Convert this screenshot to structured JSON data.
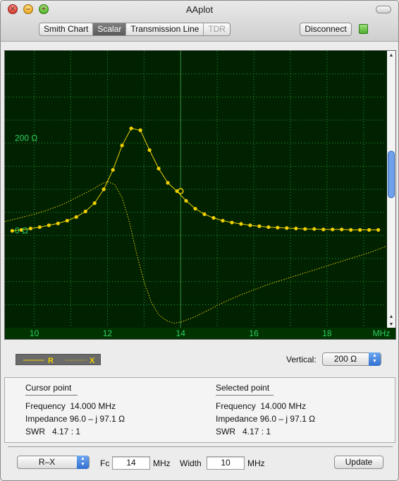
{
  "window": {
    "title": "AAplot"
  },
  "tabs": [
    {
      "label": "Smith Chart",
      "state": "normal"
    },
    {
      "label": "Scalar",
      "state": "active"
    },
    {
      "label": "Transmission Line",
      "state": "normal"
    },
    {
      "label": "TDR",
      "state": "disabled"
    }
  ],
  "toolbar": {
    "disconnect_label": "Disconnect",
    "status_led": "connected-green-led"
  },
  "chart_data": {
    "type": "line",
    "title": "",
    "xlabel": "MHz",
    "ylabel": "",
    "xlim": [
      9.2,
      19.6
    ],
    "ylim": [
      -200,
      400
    ],
    "x_ticks": [
      10,
      12,
      14,
      16,
      18
    ],
    "y_labels": [
      {
        "value": 200,
        "text": "200 Ω"
      },
      {
        "value": 0,
        "text": "0 Ω"
      }
    ],
    "cursor_x": 14,
    "selected_point": {
      "x": 14,
      "y": 96.0
    },
    "series": [
      {
        "name": "R",
        "style": "solid-with-markers",
        "x": [
          9.4,
          9.65,
          9.9,
          10.15,
          10.4,
          10.65,
          10.9,
          11.15,
          11.4,
          11.65,
          11.9,
          12.15,
          12.4,
          12.65,
          12.9,
          13.15,
          13.4,
          13.65,
          13.9,
          14.15,
          14.4,
          14.65,
          14.9,
          15.15,
          15.4,
          15.65,
          15.9,
          16.15,
          16.4,
          16.65,
          16.9,
          17.15,
          17.4,
          17.65,
          17.9,
          18.15,
          18.4,
          18.65,
          18.9,
          19.15,
          19.4
        ],
        "values": [
          10,
          12,
          15,
          18,
          22,
          26,
          32,
          40,
          52,
          70,
          100,
          142,
          195,
          232,
          228,
          185,
          145,
          114,
          96,
          75,
          58,
          46,
          38,
          32,
          28,
          25,
          22,
          20,
          18,
          17,
          16,
          15,
          14,
          14,
          13,
          13,
          13,
          12,
          12,
          12,
          12
        ]
      },
      {
        "name": "X",
        "style": "dotted",
        "x": [
          9.2,
          9.6,
          10.0,
          10.4,
          10.8,
          11.2,
          11.6,
          11.8,
          12.0,
          12.2,
          12.4,
          12.6,
          12.8,
          13.0,
          13.2,
          13.4,
          13.6,
          13.8,
          14.0,
          14.4,
          14.8,
          15.2,
          15.6,
          16.0,
          16.4,
          16.8,
          17.2,
          17.6,
          18.0,
          18.4,
          18.8,
          19.2,
          19.6
        ],
        "values": [
          30,
          38,
          46,
          56,
          68,
          84,
          100,
          110,
          117,
          110,
          82,
          30,
          -40,
          -100,
          -145,
          -172,
          -184,
          -190,
          -188,
          -176,
          -160,
          -144,
          -130,
          -118,
          -106,
          -96,
          -86,
          -76,
          -66,
          -56,
          -46,
          -36,
          -24
        ]
      }
    ]
  },
  "legend": {
    "r_label": "R",
    "x_label": "X"
  },
  "vertical": {
    "label": "Vertical:",
    "value": "200 Ω"
  },
  "cursor_point": {
    "title": "Cursor point",
    "frequency": "Frequency  14.000 MHz",
    "impedance": "Impedance 96.0 – j 97.1 Ω",
    "swr": "SWR   4.17 : 1"
  },
  "selected_point_info": {
    "title": "Selected point",
    "frequency": "Frequency  14.000 MHz",
    "impedance": "Impedance 96.0 – j 97.1 Ω",
    "swr": "SWR   4.17 : 1"
  },
  "controls": {
    "mode_value": "R–X",
    "fc_label": "Fc",
    "fc_value": "14",
    "fc_unit": "MHz",
    "width_label": "Width",
    "width_value": "10",
    "width_unit": "MHz",
    "update_label": "Update"
  },
  "colors": {
    "plot_bg": "#002200",
    "trace": "#f0d000",
    "grid_label": "#2fd060",
    "grid_line": "#2a9a3a"
  }
}
